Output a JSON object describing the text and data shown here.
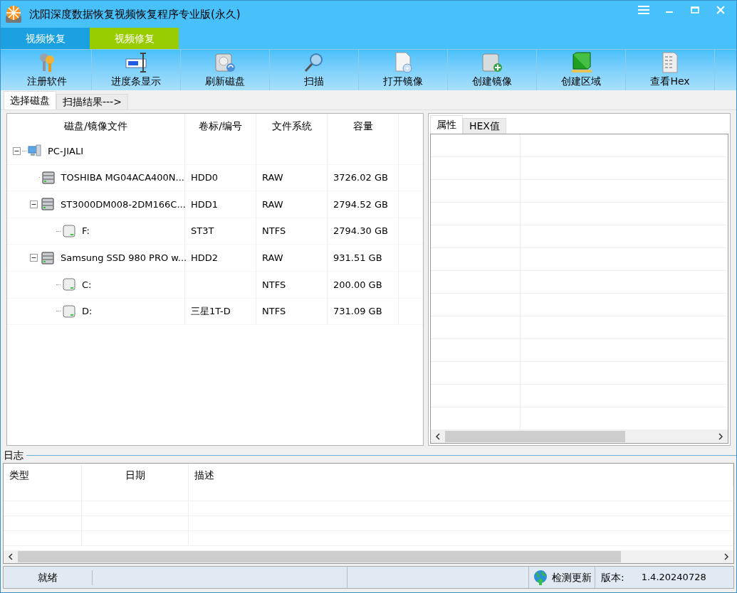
{
  "window": {
    "title": "沈阳深度数据恢复视频恢复程序专业版(永久)"
  },
  "mode_tabs": [
    {
      "label": "视频恢复",
      "selected": false
    },
    {
      "label": "视频修复",
      "selected": true
    }
  ],
  "toolbar": [
    {
      "label": "注册软件",
      "kind": "keys"
    },
    {
      "label": "进度条显示",
      "kind": "progress"
    },
    {
      "label": "刷新磁盘",
      "kind": "refresh"
    },
    {
      "label": "扫描",
      "kind": "scan"
    },
    {
      "label": "打开镜像",
      "kind": "open"
    },
    {
      "label": "创建镜像",
      "kind": "create"
    },
    {
      "label": "创建区域",
      "kind": "region"
    },
    {
      "label": "查看Hex",
      "kind": "hex"
    }
  ],
  "sub_tabs": [
    {
      "label": "选择磁盘",
      "selected": true
    },
    {
      "label": "扫描结果--->",
      "selected": false
    }
  ],
  "disk_table": {
    "columns": [
      "磁盘/镜像文件",
      "卷标/编号",
      "文件系统",
      "容量"
    ],
    "rows": [
      {
        "kind": "computer",
        "name": "PC-JIALI",
        "expanded": true,
        "children": [
          {
            "kind": "disk",
            "name": "TOSHIBA MG04ACA400N...",
            "label": "HDD0",
            "fs": "RAW",
            "size": "3726.02 GB"
          },
          {
            "kind": "disk",
            "name": "ST3000DM008-2DM166C...",
            "label": "HDD1",
            "fs": "RAW",
            "size": "2794.52 GB",
            "expanded": true,
            "children": [
              {
                "kind": "volume",
                "name": "F:",
                "label": "ST3T",
                "fs": "NTFS",
                "size": "2794.30 GB"
              }
            ]
          },
          {
            "kind": "disk",
            "name": "Samsung SSD 980 PRO w...",
            "label": "HDD2",
            "fs": "RAW",
            "size": "931.51 GB",
            "expanded": true,
            "children": [
              {
                "kind": "volume",
                "name": "C:",
                "fs": "NTFS",
                "size": "200.00 GB"
              },
              {
                "kind": "volume",
                "name": "D:",
                "label": "三星1T-D",
                "fs": "NTFS",
                "size": "731.09 GB"
              }
            ]
          }
        ]
      }
    ]
  },
  "detail_tabs": [
    {
      "label": "属性",
      "selected": true
    },
    {
      "label": "HEX值",
      "selected": false
    }
  ],
  "log": {
    "title": "日志",
    "columns": [
      "类型",
      "日期",
      "描述"
    ]
  },
  "status_bar": {
    "status": "就绪",
    "update_link": "检测更新",
    "version_label": "版本:",
    "version": "1.4.20240728"
  }
}
